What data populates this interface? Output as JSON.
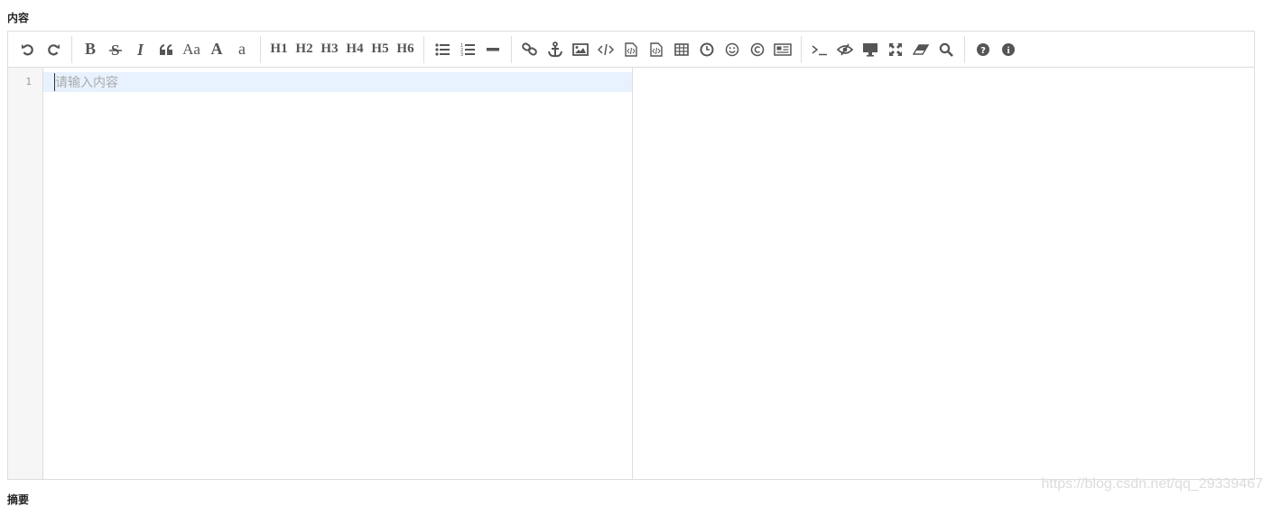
{
  "form": {
    "content_label": "内容",
    "next_label": "摘要"
  },
  "editor": {
    "line_number": "1",
    "placeholder": "请输入内容",
    "watermark": "https://blog.csdn.net/qq_29339467"
  },
  "toolbar": {
    "bold": "B",
    "uppercase": "Aa",
    "big_a": "A",
    "small_a": "a",
    "h1": "H1",
    "h2": "H2",
    "h3": "H3",
    "h4": "H4",
    "h5": "H5",
    "h6": "H6",
    "icons": [
      "undo-icon",
      "redo-icon",
      "bold",
      "strikethrough-icon",
      "italic-icon",
      "quote-icon",
      "ucwords",
      "uppercase",
      "lowercase",
      "h1",
      "h2",
      "h3",
      "h4",
      "h5",
      "h6",
      "list-ul-icon",
      "list-ol-icon",
      "hr-icon",
      "link-icon",
      "anchor-icon",
      "image-icon",
      "code-icon",
      "preformatted-code-icon",
      "code-block-icon",
      "table-icon",
      "datetime-icon",
      "emoji-icon",
      "html-entities-icon",
      "pagebreak-icon",
      "goto-line-icon",
      "watch-icon",
      "preview-icon",
      "fullscreen-icon",
      "clear-icon",
      "search-icon",
      "help-icon",
      "info-icon"
    ]
  },
  "colors": {
    "icon": "#555555",
    "border": "#dddddd",
    "gutter_bg": "#f6f6f6",
    "active_line": "#e8f2fe"
  }
}
